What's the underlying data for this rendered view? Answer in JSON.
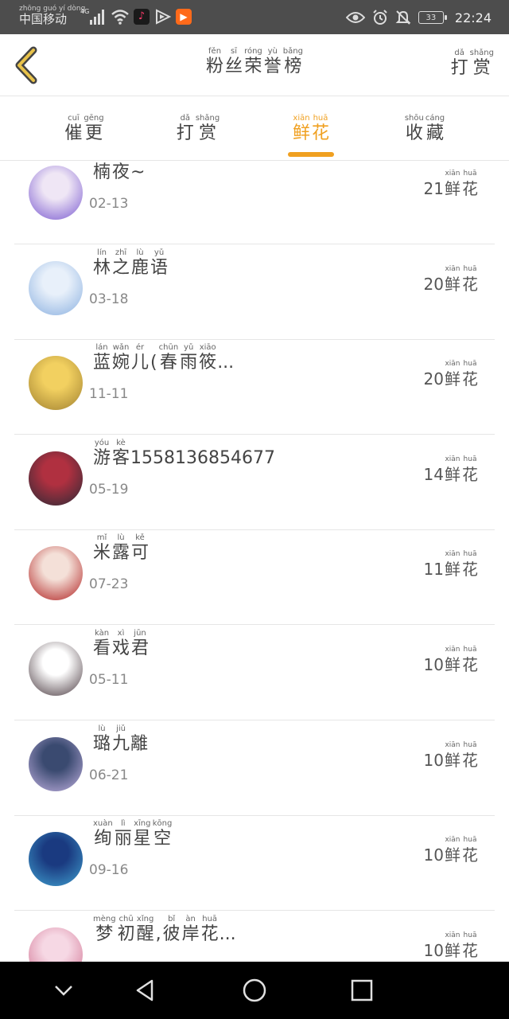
{
  "status_bar": {
    "carrier_pinyin": "zhōng guó  yí  dòng",
    "carrier": "中国移动",
    "network": "4G",
    "battery": "33",
    "time": "22:24"
  },
  "header": {
    "title": [
      {
        "py": "fěn",
        "hz": "粉"
      },
      {
        "py": "sī",
        "hz": "丝"
      },
      {
        "py": "róng",
        "hz": "荣"
      },
      {
        "py": "yù",
        "hz": "誉"
      },
      {
        "py": "bǎng",
        "hz": "榜"
      }
    ],
    "reward_link": [
      {
        "py": "dǎ",
        "hz": "打"
      },
      {
        "py": "shǎng",
        "hz": "赏"
      }
    ]
  },
  "tabs": [
    {
      "chars": [
        {
          "py": "cuī",
          "hz": "催"
        },
        {
          "py": "gēng",
          "hz": "更"
        }
      ]
    },
    {
      "chars": [
        {
          "py": "dǎ",
          "hz": "打"
        },
        {
          "py": "shǎng",
          "hz": "赏"
        }
      ]
    },
    {
      "chars": [
        {
          "py": "xiān",
          "hz": "鲜"
        },
        {
          "py": "huā",
          "hz": "花"
        }
      ],
      "active": true
    },
    {
      "chars": [
        {
          "py": "shōu",
          "hz": "收"
        },
        {
          "py": "cáng",
          "hz": "藏"
        }
      ]
    }
  ],
  "unit": [
    {
      "py": "xiān",
      "hz": "鲜"
    },
    {
      "py": "huā",
      "hz": "花"
    }
  ],
  "rows": [
    {
      "name": [
        {
          "py": "nán",
          "hz": "楠"
        },
        {
          "py": "yè",
          "hz": "夜"
        }
      ],
      "suffix": "~",
      "date": "02-13",
      "count": "21",
      "colors": [
        "#efe6f5",
        "#7a5ad0"
      ]
    },
    {
      "name": [
        {
          "py": "lín",
          "hz": "林"
        },
        {
          "py": "zhī",
          "hz": "之"
        },
        {
          "py": "lù",
          "hz": "鹿"
        },
        {
          "py": "yǔ",
          "hz": "语"
        }
      ],
      "suffix": "",
      "date": "03-18",
      "count": "20",
      "colors": [
        "#e8f0fa",
        "#8ab0e0"
      ]
    },
    {
      "name": [
        {
          "py": "lán",
          "hz": "蓝"
        },
        {
          "py": "wǎn",
          "hz": "婉"
        },
        {
          "py": "ér",
          "hz": "儿"
        },
        {
          "py": "",
          "hz": "("
        },
        {
          "py": "chūn",
          "hz": "春"
        },
        {
          "py": "yǔ",
          "hz": "雨"
        },
        {
          "py": "xiāo",
          "hz": "筱"
        }
      ],
      "suffix": "...",
      "date": "11-11",
      "count": "20",
      "colors": [
        "#f2d060",
        "#a08030"
      ]
    },
    {
      "name": [
        {
          "py": "yóu",
          "hz": "游"
        },
        {
          "py": "kè",
          "hz": "客"
        }
      ],
      "suffix": "1558136854677",
      "date": "05-19",
      "count": "14",
      "colors": [
        "#b03040",
        "#2a2a36"
      ]
    },
    {
      "name": [
        {
          "py": "mǐ",
          "hz": "米"
        },
        {
          "py": "lù",
          "hz": "露"
        },
        {
          "py": "kě",
          "hz": "可"
        }
      ],
      "suffix": "",
      "date": "07-23",
      "count": "11",
      "colors": [
        "#f4e0d8",
        "#b02020"
      ]
    },
    {
      "name": [
        {
          "py": "kàn",
          "hz": "看"
        },
        {
          "py": "xì",
          "hz": "戏"
        },
        {
          "py": "jūn",
          "hz": "君"
        }
      ],
      "suffix": "",
      "date": "05-11",
      "count": "10",
      "colors": [
        "#ffffff",
        "#4a3a40"
      ]
    },
    {
      "name": [
        {
          "py": "lù",
          "hz": "璐"
        },
        {
          "py": "jiǔ",
          "hz": "九"
        }
      ],
      "suffix": "離",
      "date": "06-21",
      "count": "10",
      "colors": [
        "#3a4a70",
        "#c0b0e0"
      ]
    },
    {
      "name": [
        {
          "py": "xuàn",
          "hz": "绚"
        },
        {
          "py": "lì",
          "hz": "丽"
        },
        {
          "py": "xīng",
          "hz": "星"
        },
        {
          "py": "kōng",
          "hz": "空"
        }
      ],
      "suffix": "",
      "date": "09-16",
      "count": "10",
      "colors": [
        "#1a3a80",
        "#40a0d0"
      ]
    },
    {
      "name": [
        {
          "py": "mèng",
          "hz": "梦"
        },
        {
          "py": "chū",
          "hz": "初"
        },
        {
          "py": "xǐng",
          "hz": "醒"
        },
        {
          "py": "",
          "hz": ","
        },
        {
          "py": "bǐ",
          "hz": "彼"
        },
        {
          "py": "àn",
          "hz": "岸"
        },
        {
          "py": "huā",
          "hz": "花"
        }
      ],
      "suffix": "...",
      "date": "",
      "count": "10",
      "colors": [
        "#f6d8e4",
        "#d07090"
      ]
    }
  ]
}
